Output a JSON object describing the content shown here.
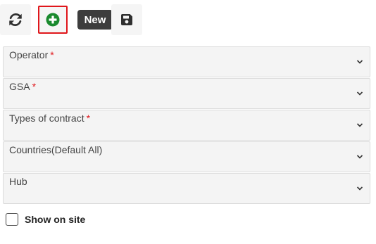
{
  "toolbar": {
    "refresh_icon": "refresh-icon",
    "add_icon": "plus-circle-icon",
    "save_icon": "floppy-disk-icon",
    "tooltip": "New",
    "accent_green": "#1a8a2e",
    "highlight_border": "#e0161b"
  },
  "form": {
    "fields": [
      {
        "label": "Operator",
        "required": "*"
      },
      {
        "label": "GSA",
        "required": "*"
      },
      {
        "label": "Types of contract",
        "required": "*"
      },
      {
        "label": "Countries(Default All)",
        "required": ""
      },
      {
        "label": "Hub",
        "required": ""
      }
    ],
    "show_on_site_label": "Show on site",
    "show_on_site_checked": false
  }
}
